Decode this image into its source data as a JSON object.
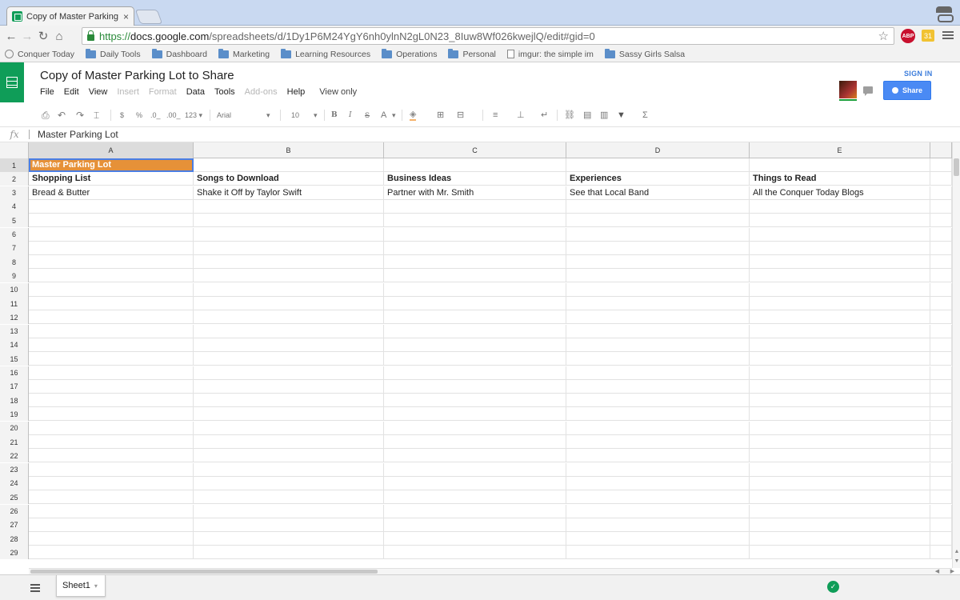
{
  "browser": {
    "tab_title": "Copy of Master Parking Lo",
    "tab_close": "×",
    "url_scheme": "https://",
    "url_host": "docs.google.com",
    "url_path": "/spreadsheets/d/1Dy1P6M24YgY6nh0ylnN2gL0N23_8Iuw8Wf026kwejlQ/edit#gid=0",
    "ext_abp": "ABP",
    "ext_other": "31",
    "bookmarks": [
      {
        "label": "Conquer Today",
        "icon": "globe-icon"
      },
      {
        "label": "Daily Tools",
        "icon": "folder-icon"
      },
      {
        "label": "Dashboard",
        "icon": "folder-icon"
      },
      {
        "label": "Marketing",
        "icon": "folder-icon"
      },
      {
        "label": "Learning Resources",
        "icon": "folder-icon"
      },
      {
        "label": "Operations",
        "icon": "folder-icon"
      },
      {
        "label": "Personal",
        "icon": "folder-icon"
      },
      {
        "label": "imgur: the simple im",
        "icon": "page-icon"
      },
      {
        "label": "Sassy Girls Salsa",
        "icon": "folder-icon"
      }
    ]
  },
  "sheets": {
    "doc_title": "Copy of Master Parking Lot to Share",
    "menu": [
      "File",
      "Edit",
      "View",
      "Insert",
      "Format",
      "Data",
      "Tools",
      "Add-ons",
      "Help"
    ],
    "menu_disabled": [
      "Insert",
      "Format",
      "Add-ons"
    ],
    "view_only": "View only",
    "signin": "SIGN IN",
    "share": "Share",
    "toolbar": {
      "currency": "$",
      "percent": "%",
      "dec_less": ".0_",
      "dec_more": ".00_",
      "more_formats": "123 ▾",
      "font": "Arial",
      "font_size": "10",
      "bold": "B",
      "italic": "I",
      "strike": "S",
      "text_color": "A",
      "sigma": "Σ"
    },
    "formula_bar": {
      "fx": "fx",
      "value": "Master Parking Lot"
    },
    "columns": [
      "A",
      "B",
      "C",
      "D",
      "E"
    ],
    "rows": [
      [
        "Master Parking Lot",
        "",
        "",
        "",
        ""
      ],
      [
        "Shopping List",
        "Songs to Download",
        "Business Ideas",
        "Experiences",
        "Things to Read"
      ],
      [
        "Bread & Butter",
        "Shake it Off by Taylor Swift",
        "Partner with Mr. Smith",
        "See that Local Band",
        "All the Conquer Today Blogs"
      ]
    ],
    "row_count": 29,
    "active_cell": "A1",
    "active_cell_color": "#e69138",
    "sheet_tab": "Sheet1"
  },
  "colors": {
    "brand_green": "#0f9d58",
    "share_blue": "#4a8af4",
    "link_blue": "#3b7cdb"
  }
}
